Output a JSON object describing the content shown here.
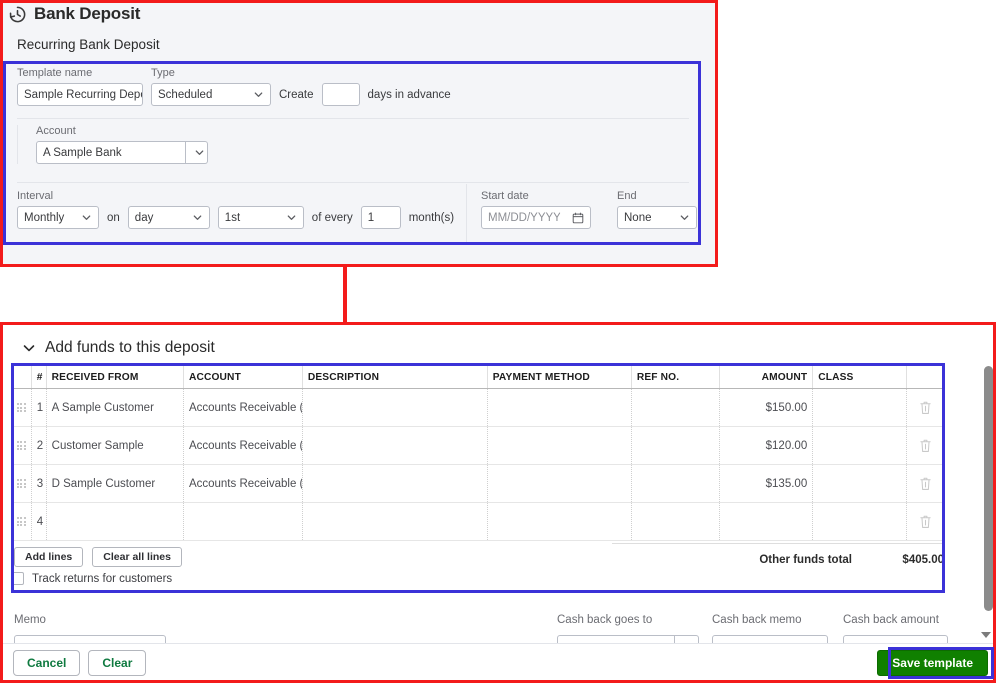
{
  "header": {
    "title": "Bank Deposit",
    "icon": "recurring-clock-icon",
    "subtitle": "Recurring Bank Deposit"
  },
  "template_form": {
    "template_name": {
      "label": "Template name",
      "value": "Sample Recurring Depo"
    },
    "type": {
      "label": "Type",
      "value": "Scheduled"
    },
    "create_prefix": "Create",
    "create_days_value": "",
    "create_suffix": "days in advance",
    "account": {
      "label": "Account",
      "value": "A Sample Bank"
    },
    "interval": {
      "label": "Interval",
      "frequency": "Monthly",
      "on_word": "on",
      "day_type": "day",
      "day_ordinal": "1st",
      "of_every": "of every",
      "every_count": "1",
      "month_unit": "month(s)"
    },
    "start_date": {
      "label": "Start date",
      "placeholder": "MM/DD/YYYY",
      "value": ""
    },
    "end": {
      "label": "End",
      "value": "None"
    }
  },
  "deposit_section": {
    "title": "Add funds to this deposit",
    "collapse_icon": "chevron-down-icon",
    "columns": [
      {
        "key": "grip",
        "label": ""
      },
      {
        "key": "num",
        "label": "#"
      },
      {
        "key": "received_from",
        "label": "RECEIVED FROM"
      },
      {
        "key": "account",
        "label": "ACCOUNT"
      },
      {
        "key": "description",
        "label": "DESCRIPTION"
      },
      {
        "key": "payment_method",
        "label": "PAYMENT METHOD"
      },
      {
        "key": "ref_no",
        "label": "REF NO."
      },
      {
        "key": "amount",
        "label": "AMOUNT"
      },
      {
        "key": "class",
        "label": "CLASS"
      },
      {
        "key": "delete",
        "label": ""
      }
    ],
    "rows": [
      {
        "num": "1",
        "received_from": "A Sample Customer",
        "account": "Accounts Receivable (A/R",
        "description": "",
        "payment_method": "",
        "ref_no": "",
        "amount": "$150.00",
        "class": ""
      },
      {
        "num": "2",
        "received_from": "Customer Sample",
        "account": "Accounts Receivable (A/R",
        "description": "",
        "payment_method": "",
        "ref_no": "",
        "amount": "$120.00",
        "class": ""
      },
      {
        "num": "3",
        "received_from": "D Sample Customer",
        "account": "Accounts Receivable (A/R",
        "description": "",
        "payment_method": "",
        "ref_no": "",
        "amount": "$135.00",
        "class": ""
      },
      {
        "num": "4",
        "received_from": "",
        "account": "",
        "description": "",
        "payment_method": "",
        "ref_no": "",
        "amount": "",
        "class": ""
      }
    ],
    "add_lines_label": "Add lines",
    "clear_all_lines_label": "Clear all lines",
    "track_returns_label": "Track returns for customers",
    "track_returns_checked": false,
    "other_funds_total_label": "Other funds total",
    "other_funds_total_value": "$405.00"
  },
  "footer_fields": {
    "memo": {
      "label": "Memo",
      "value": ""
    },
    "cash_back_goes_to": {
      "label": "Cash back goes to",
      "value": ""
    },
    "cash_back_memo": {
      "label": "Cash back memo",
      "value": ""
    },
    "cash_back_amount": {
      "label": "Cash back amount",
      "value": ""
    }
  },
  "footer_buttons": {
    "cancel": "Cancel",
    "clear": "Clear",
    "save_template": "Save template"
  },
  "colors": {
    "annotation_red": "#f31b1b",
    "annotation_blue": "#3b32d8",
    "save_green": "#108000",
    "link_green": "#0f7a40",
    "panel_bg": "#f4f5f8"
  }
}
